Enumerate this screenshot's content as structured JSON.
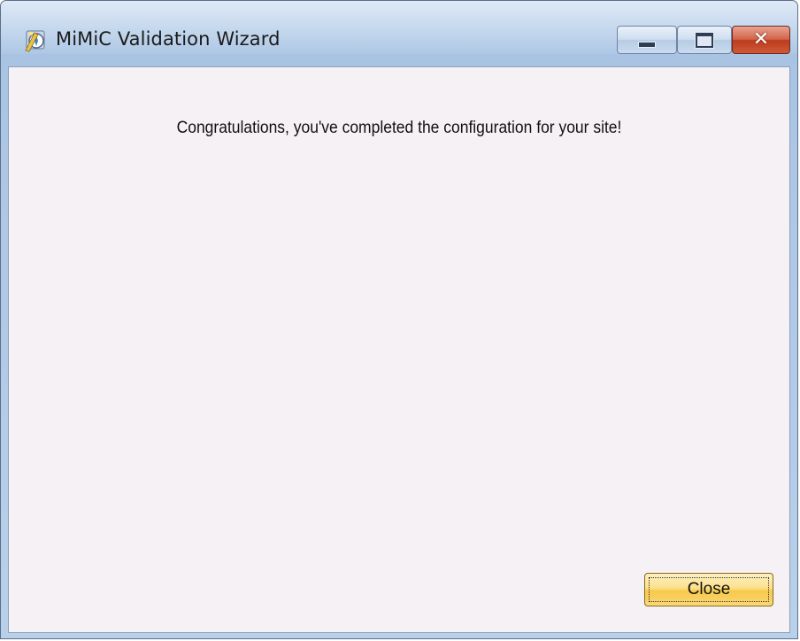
{
  "window": {
    "title": "MiMiC Validation Wizard",
    "icon": "wizard-app-icon",
    "controls": {
      "minimize_icon": "minimize-icon",
      "maximize_icon": "maximize-icon",
      "close_icon": "close-icon",
      "close_glyph": "✕"
    }
  },
  "content": {
    "message": "Congratulations, you've completed the configuration for your site!"
  },
  "buttons": {
    "close_label": "Close"
  },
  "colors": {
    "client_background": "#f6f1f5",
    "close_button_accent": "#f7c94a",
    "titlebar_close_red": "#c8492a"
  }
}
